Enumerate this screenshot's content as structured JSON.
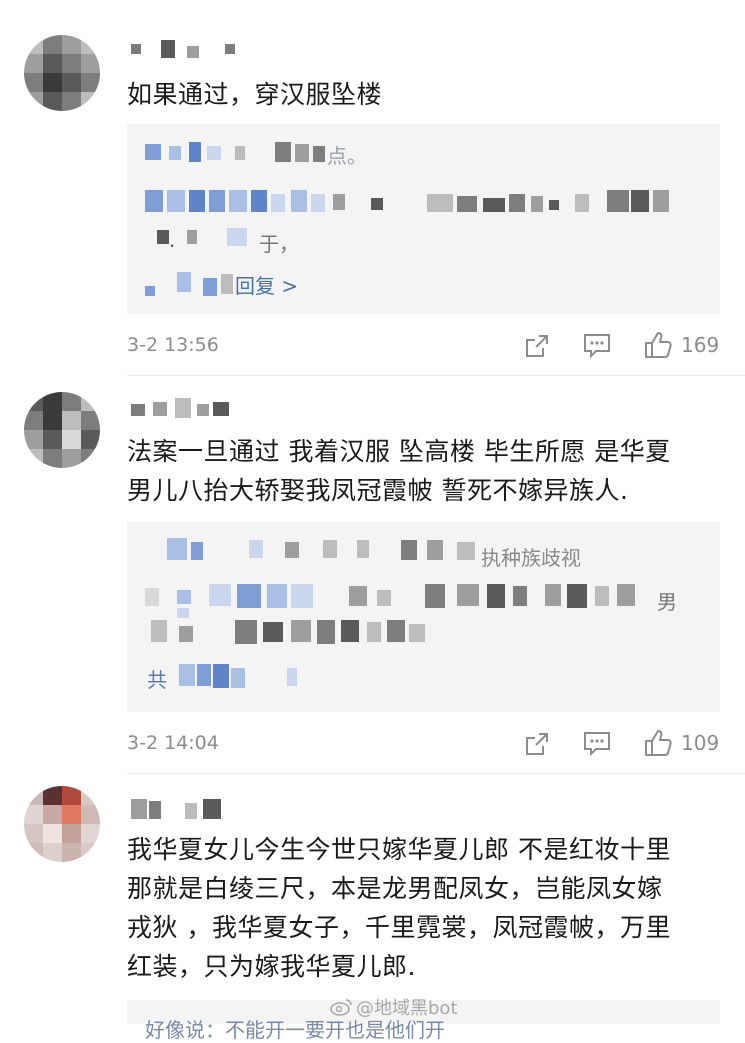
{
  "comments": [
    {
      "body": "如果通过，穿汉服坠楼",
      "reply_preview_fragment": "点。",
      "reply_preview_fragment_2": "于，",
      "reply_link": "回复 >",
      "time": "3-2 13:56",
      "likes": "169"
    },
    {
      "body_line_1": "法案一旦通过 我着汉服 坠高楼 毕生所愿 是华夏",
      "body_line_2": "男儿八抬大轿娶我凤冠霞帔 誓死不嫁异族人.",
      "reply_preview_fragment": "执种族歧视",
      "reply_preview_fragment_2": "男",
      "reply_preview_fragment_3": "共",
      "time": "3-2 14:04",
      "likes": "109"
    },
    {
      "body_line_1": "我华夏女儿今生今世只嫁华夏儿郎 不是红妆十里",
      "body_line_2": "那就是白绫三尺，本是龙男配凤女，岂能凤女嫁",
      "body_line_3": "戎狄 ，我华夏女子，千里霓裳，凤冠霞帔，万里",
      "body_line_4": "红装，只为嫁我华夏儿郎.",
      "reply_preview_fragment": "好像说：不能开一要开也是他们开"
    }
  ],
  "watermark": "@地域黑bot",
  "icons": {
    "share": "share-icon",
    "comment": "comment-icon",
    "like": "thumbs-up-icon"
  },
  "colors": {
    "reply_bg": "#f4f4f4",
    "link_blue": "#4a6fa5",
    "meta_gray": "#8c8c8c"
  }
}
